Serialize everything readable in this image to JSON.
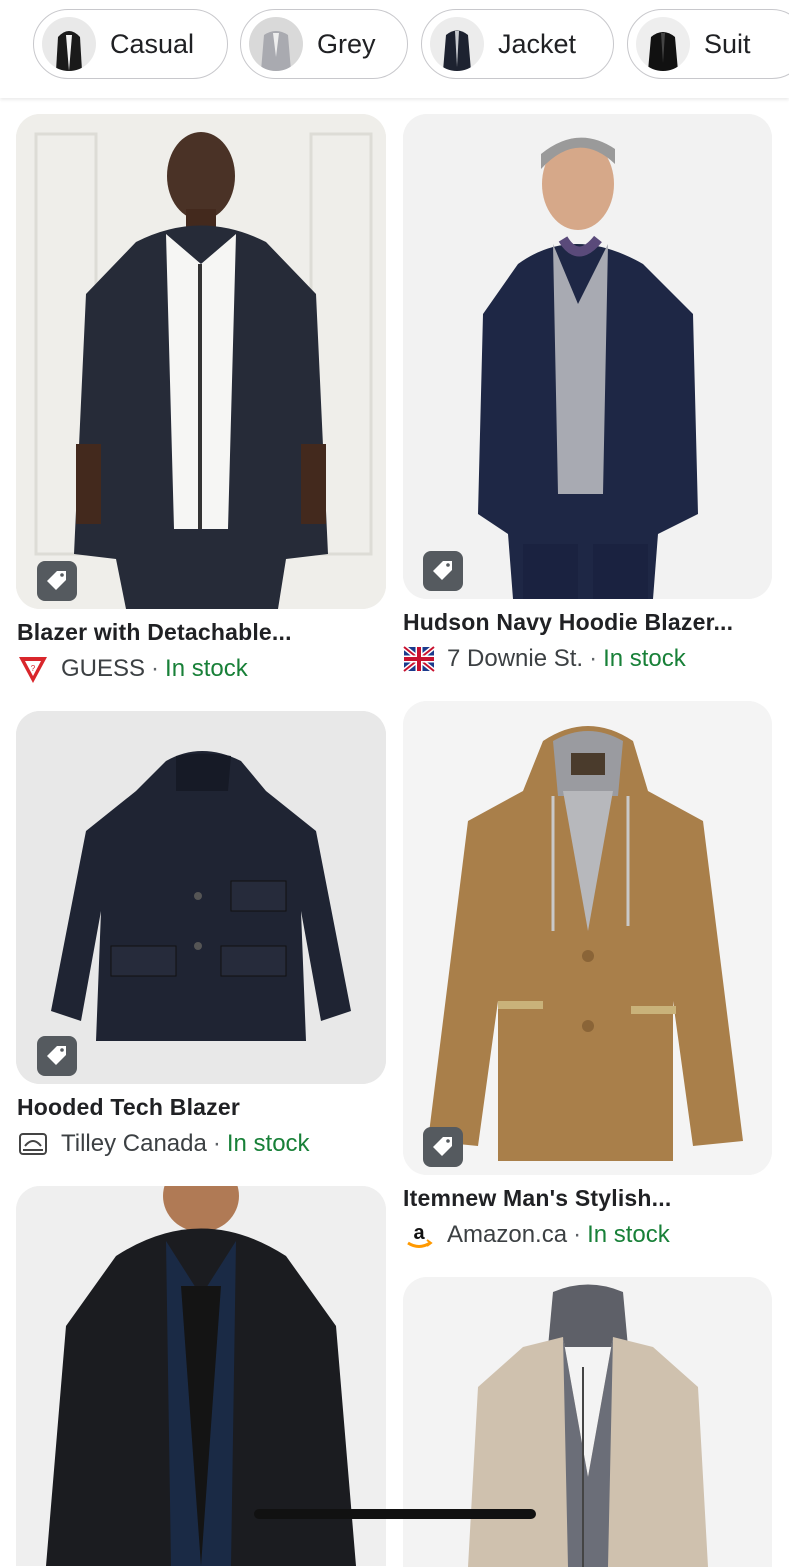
{
  "chips": [
    {
      "label": "Casual",
      "icon": "black-jacket-thumb"
    },
    {
      "label": "Grey",
      "icon": "grey-blazer-thumb"
    },
    {
      "label": "Jacket",
      "icon": "navy-jacket-thumb"
    },
    {
      "label": "Suit",
      "icon": "black-suit-thumb"
    }
  ],
  "products": [
    {
      "title": "Blazer with Detachable...",
      "store": "GUESS",
      "sep": "·",
      "stock": "In stock",
      "store_icon": "guess-logo-icon",
      "image": "man-navy-hooded-blazer"
    },
    {
      "title": "Hudson Navy Hoodie Blazer...",
      "store": "7 Downie St.",
      "sep": "·",
      "stock": "In stock",
      "store_icon": "union-jack-icon",
      "image": "grey-haired-man-navy-blazer"
    },
    {
      "title": "Hooded Tech Blazer",
      "store": "Tilley Canada",
      "sep": "·",
      "stock": "In stock",
      "store_icon": "tilley-logo-icon",
      "image": "navy-hooded-tech-blazer"
    },
    {
      "title": "Itemnew Man's Stylish...",
      "store": "Amazon.ca",
      "sep": "·",
      "stock": "In stock",
      "store_icon": "amazon-logo-icon",
      "image": "tan-hooded-blazer"
    },
    {
      "title": "",
      "store": "",
      "sep": "",
      "stock": "",
      "store_icon": "",
      "image": "man-black-hooded-jacket"
    },
    {
      "title": "",
      "store": "",
      "sep": "",
      "stock": "",
      "store_icon": "",
      "image": "beige-hooded-blazer"
    }
  ],
  "colors": {
    "stock": "#188038",
    "tag_bg": "#555a5f",
    "text": "#202124"
  }
}
